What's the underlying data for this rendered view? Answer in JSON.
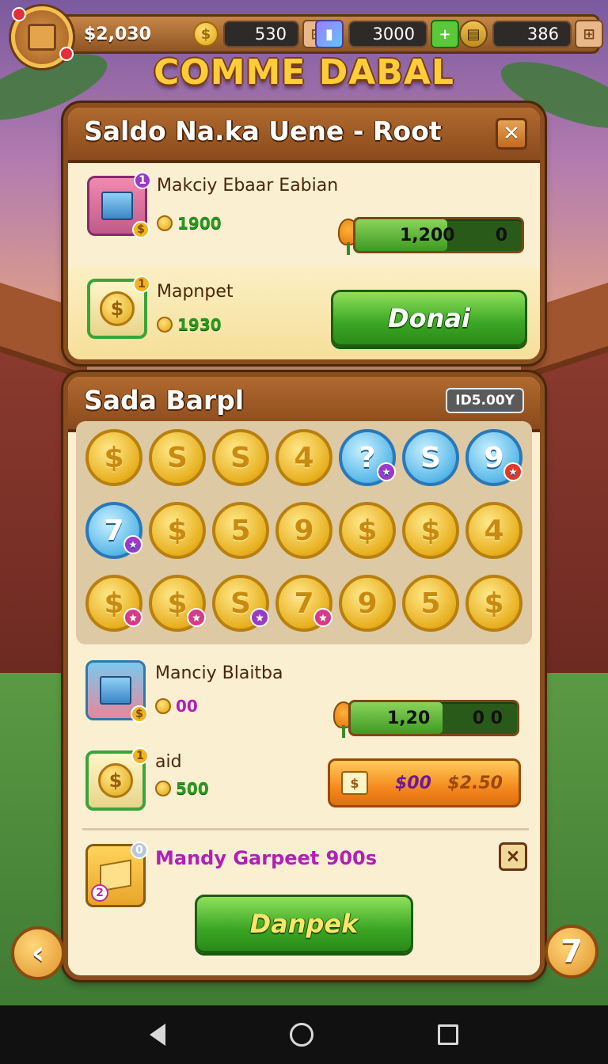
{
  "top_bar": {
    "money": "$2,030",
    "resources": [
      {
        "icon": "gold-coin-icon",
        "value": "530"
      },
      {
        "icon": "crystal-icon",
        "value": "3000"
      },
      {
        "icon": "book-icon",
        "value": "386"
      }
    ]
  },
  "game_title": "COMME DABAL",
  "panel1": {
    "title": "Saldo Na.ka Uene - Root",
    "close_label": "✕",
    "items": [
      {
        "name": "Makciy Ebaar Eabian",
        "price": "1900",
        "badge": "1",
        "progress_label": "1,200",
        "progress_extra": "0",
        "progress_fraction": 0.55
      },
      {
        "name": "Mapnpet",
        "price": "1930",
        "badge": "1",
        "action_label": "Donai"
      }
    ]
  },
  "panel2": {
    "title": "Sada Barpl",
    "tag": "ID5.00Y",
    "coins": [
      {
        "type": "gold",
        "label": "$"
      },
      {
        "type": "gold",
        "label": "S"
      },
      {
        "type": "gold",
        "label": "S"
      },
      {
        "type": "gold",
        "label": "4"
      },
      {
        "type": "blue",
        "label": "?",
        "badge": "purple"
      },
      {
        "type": "blue",
        "label": "S"
      },
      {
        "type": "blue",
        "label": "9",
        "badge": "red"
      },
      {
        "type": "blue",
        "label": "7",
        "badge": "purple"
      },
      {
        "type": "gold",
        "label": "$"
      },
      {
        "type": "gold",
        "label": "5"
      },
      {
        "type": "gold",
        "label": "9"
      },
      {
        "type": "gold",
        "label": "$"
      },
      {
        "type": "gold",
        "label": "$"
      },
      {
        "type": "gold",
        "label": "4"
      },
      {
        "type": "gold",
        "label": "$",
        "badge": "pink"
      },
      {
        "type": "gold",
        "label": "$",
        "badge": "pink"
      },
      {
        "type": "gold",
        "label": "S",
        "badge": "purple"
      },
      {
        "type": "gold",
        "label": "7",
        "badge": "pink"
      },
      {
        "type": "gold",
        "label": "9"
      },
      {
        "type": "gold",
        "label": "5"
      },
      {
        "type": "gold",
        "label": "$"
      }
    ],
    "items": [
      {
        "name": "Manciy Blaitba",
        "price": "00",
        "progress_label": "1,20",
        "progress_extra": "0 0",
        "progress_fraction": 0.55
      },
      {
        "name": "aid",
        "price": "500",
        "badge": "1",
        "buy_left": "$00",
        "buy_right": "$2.50"
      }
    ],
    "bottom_item": {
      "name": "Mandy Garpeet 900s",
      "badge_top": "0",
      "badge_bottom": "2",
      "action_label": "Danpek"
    }
  },
  "nav": {
    "left_label": "‹",
    "right_label": "7"
  },
  "colors": {
    "accent_gold": "#ffcc3a",
    "wood": "#8a4d1e",
    "green_button": "#3aa624",
    "orange_button": "#f58a1e"
  }
}
